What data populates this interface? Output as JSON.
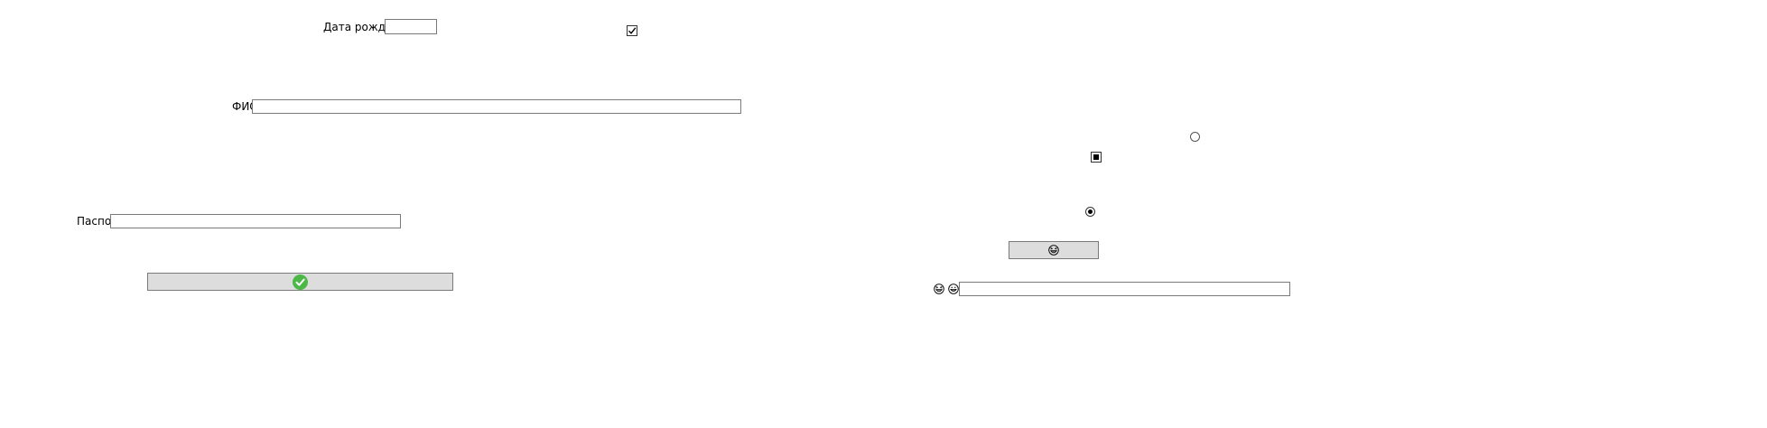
{
  "form": {
    "birth_date": {
      "label": "Дата рождения",
      "value": ""
    },
    "fio": {
      "label": "ФИО",
      "value": ""
    },
    "passport": {
      "label": "Паспорт",
      "value": ""
    },
    "submit_icon": "check-circle-icon",
    "submit_color": "#4cb848"
  },
  "controls": {
    "checkbox": {
      "checked": true
    },
    "checkbox_indeterminate": {
      "state": "indeterminate"
    },
    "radio_empty": {
      "checked": false
    },
    "radio_selected": {
      "checked": true
    },
    "emoji_button": {
      "icon": "grinning-squint-face-icon"
    },
    "emoji_field": {
      "icons": [
        "grinning-squint-face-icon",
        "grinning-face-icon"
      ],
      "value": ""
    }
  }
}
